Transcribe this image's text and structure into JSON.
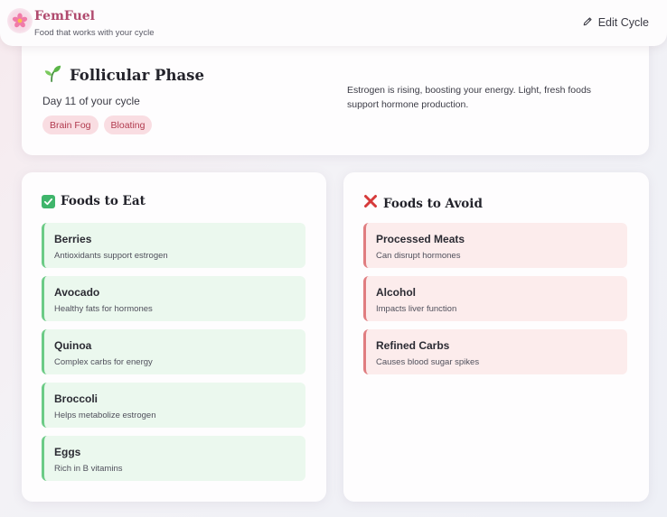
{
  "app": {
    "name": "FemFuel",
    "tagline": "Food that works with your cycle",
    "edit_label": "Edit Cycle"
  },
  "phase": {
    "title": "Follicular Phase",
    "day_text": "Day 11 of your cycle",
    "symptoms": [
      "Brain Fog",
      "Bloating"
    ],
    "description": "Estrogen is rising, boosting your energy. Light, fresh foods support hormone production."
  },
  "foods_to_eat": {
    "title": "Foods to Eat",
    "items": [
      {
        "name": "Berries",
        "note": "Antioxidants support estrogen"
      },
      {
        "name": "Avocado",
        "note": "Healthy fats for hormones"
      },
      {
        "name": "Quinoa",
        "note": "Complex carbs for energy"
      },
      {
        "name": "Broccoli",
        "note": "Helps metabolize estrogen"
      },
      {
        "name": "Eggs",
        "note": "Rich in B vitamins"
      }
    ]
  },
  "foods_to_avoid": {
    "title": "Foods to Avoid",
    "items": [
      {
        "name": "Processed Meats",
        "note": "Can disrupt hormones"
      },
      {
        "name": "Alcohol",
        "note": "Impacts liver function"
      },
      {
        "name": "Refined Carbs",
        "note": "Causes blood sugar spikes"
      }
    ]
  },
  "icons": {
    "logo": "flower-icon",
    "edit": "pencil-icon",
    "phase": "sprout-icon",
    "eat": "check-icon",
    "avoid": "cross-icon"
  },
  "colors": {
    "brand": "#b04a6e",
    "chip_bg": "#f9dde2",
    "chip_text": "#b13a4e",
    "eat_accent": "#6ccb86",
    "eat_bg": "#ebf8ee",
    "avoid_accent": "#e07d80",
    "avoid_bg": "#fcecec"
  }
}
